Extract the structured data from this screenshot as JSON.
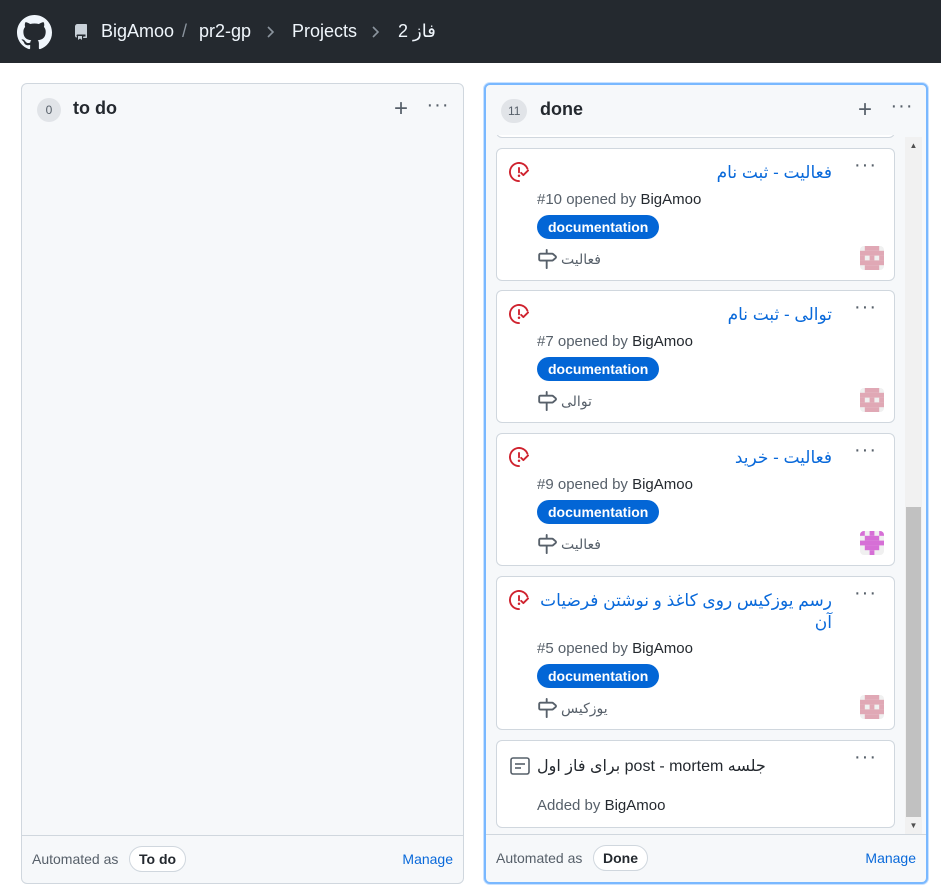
{
  "header": {
    "owner": "BigAmoo",
    "separator": "/",
    "repo": "pr2-gp",
    "projects": "Projects",
    "project_name": "فاز 2"
  },
  "columns": {
    "todo": {
      "count": "0",
      "title": "to do",
      "automated_label": "Automated as",
      "automated_value": "To do",
      "manage": "Manage"
    },
    "done": {
      "count": "11",
      "title": "done",
      "automated_label": "Automated as",
      "automated_value": "Done",
      "manage": "Manage",
      "cards": [
        {
          "title": "فعالیت - ثبت نام",
          "number": "#10 opened by",
          "author": "BigAmoo",
          "label": "documentation",
          "milestone": "فعالیت",
          "avatar_color": "#e0a8b5"
        },
        {
          "title": "توالی - ثبت نام",
          "number": "#7 opened by",
          "author": "BigAmoo",
          "label": "documentation",
          "milestone": "توالی",
          "avatar_color": "#e0a8b5"
        },
        {
          "title": "فعالیت - خرید",
          "number": "#9 opened by",
          "author": "BigAmoo",
          "label": "documentation",
          "milestone": "فعالیت",
          "avatar_color": "#d66fd6"
        },
        {
          "title": "رسم یوزکیس روی کاغذ و نوشتن فرضیات آن",
          "number": "#5 opened by",
          "author": "BigAmoo",
          "label": "documentation",
          "milestone": "یوزکیس",
          "avatar_color": "#e0a8b5"
        }
      ],
      "note": {
        "text": "جلسه post - mortem برای فاز اول",
        "added_by": "Added by",
        "author": "BigAmoo"
      }
    }
  },
  "colors": {
    "header_bg": "#24292f",
    "link_blue": "#0969da",
    "label_blue": "#0366d6",
    "issue_closed_red": "#cf222e",
    "active_column_border": "#79b8ff"
  },
  "icons": {
    "logo": "github-mark-icon",
    "repo": "repo-icon",
    "chevron": "chevron-right-icon",
    "plus": "plus-icon",
    "kebab": "kebab-horizontal-icon",
    "issue": "issue-closed-icon",
    "milestone": "milestone-icon",
    "note": "note-icon"
  }
}
